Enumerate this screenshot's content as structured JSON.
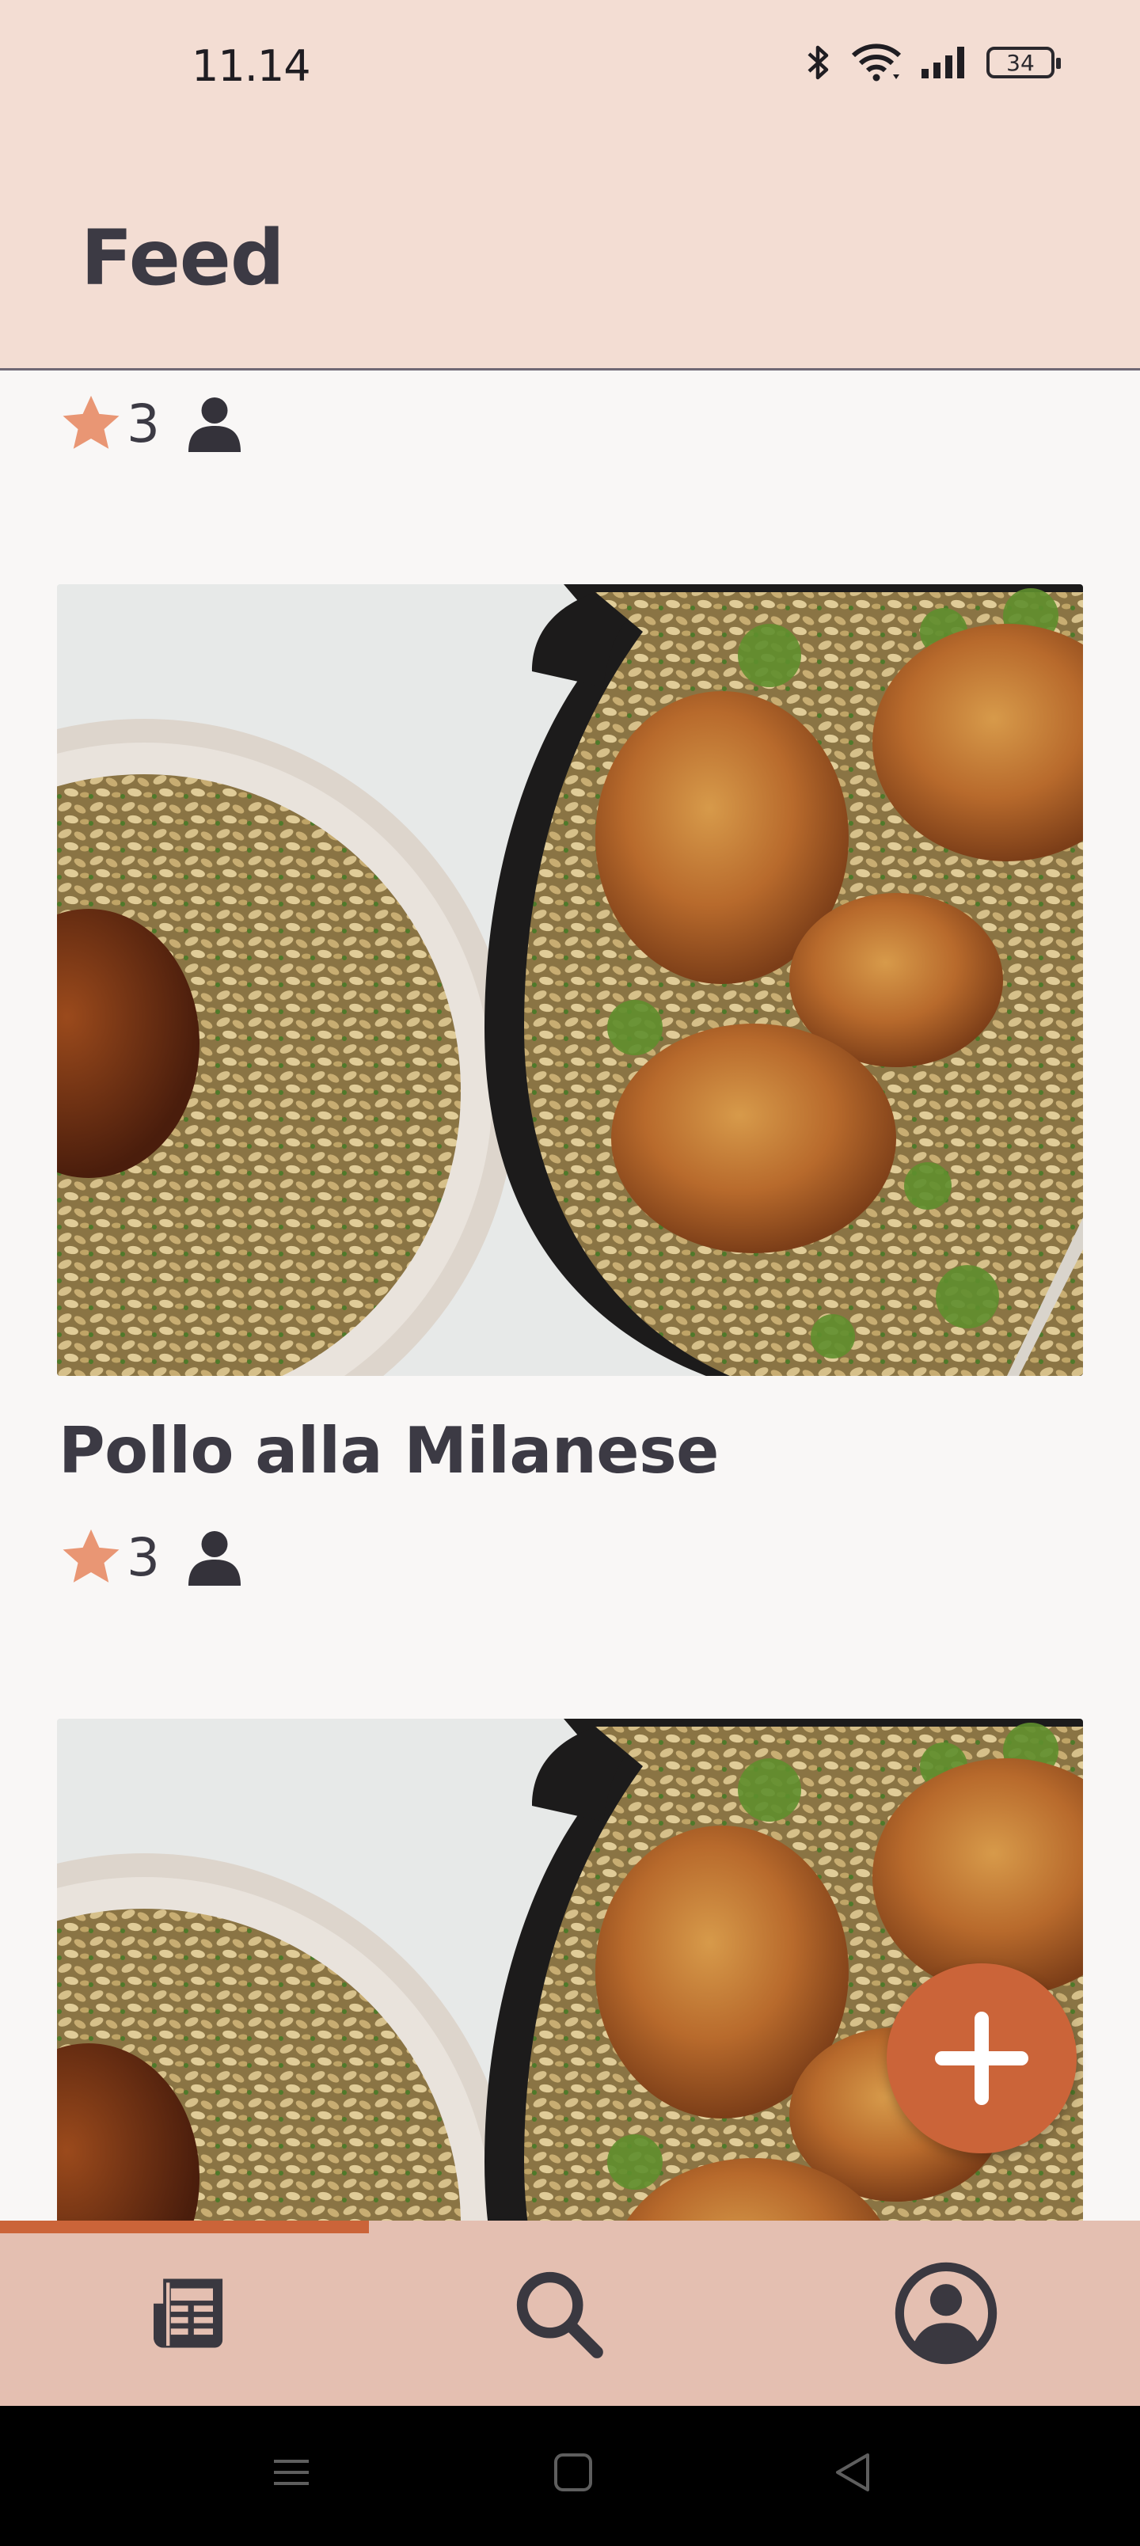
{
  "status_bar": {
    "time": "11.14",
    "battery": "34"
  },
  "header": {
    "title": "Feed"
  },
  "feed": {
    "partial_item": {
      "rating": "3"
    },
    "items": [
      {
        "title": "Pollo alla Milanese",
        "rating": "3",
        "image": "chicken-orzo-skillet"
      },
      {
        "title": "",
        "rating": "",
        "image": "chicken-orzo-skillet"
      }
    ]
  },
  "fab": {
    "icon": "plus-icon"
  },
  "bottom_nav": {
    "items": [
      {
        "icon": "feed-icon",
        "active": true
      },
      {
        "icon": "search-icon",
        "active": false
      },
      {
        "icon": "account-circle-icon",
        "active": false
      }
    ]
  },
  "colors": {
    "header_bg": "#f3ddd3",
    "accent": "#cb6439",
    "star": "#e99674",
    "bottom_nav_bg": "#e4bfb1"
  }
}
